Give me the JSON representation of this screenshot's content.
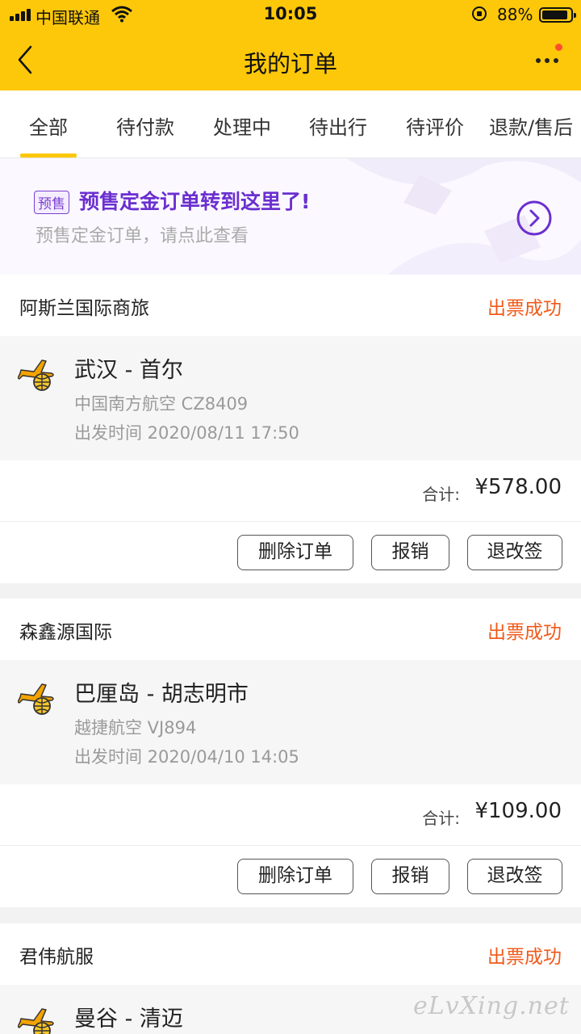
{
  "status_bar": {
    "carrier": "中国联通",
    "time": "10:05",
    "battery": "88%"
  },
  "nav": {
    "title": "我的订单",
    "back_icon": "chevron-left-icon",
    "more_icon": "more-dots-icon"
  },
  "tabs": [
    {
      "label": "全部",
      "active": true
    },
    {
      "label": "待付款",
      "active": false
    },
    {
      "label": "处理中",
      "active": false
    },
    {
      "label": "待出行",
      "active": false
    },
    {
      "label": "待评价",
      "active": false
    },
    {
      "label": "退款/售后",
      "active": false
    }
  ],
  "banner": {
    "badge": "预售",
    "title": "预售定金订单转到这里了!",
    "subtitle": "预售定金订单，请点此查看",
    "color": "#6b2fd0"
  },
  "orders": [
    {
      "shop": "阿斯兰国际商旅",
      "status": "出票成功",
      "route": "武汉 - 首尔",
      "airline": "中国南方航空 CZ8409",
      "depart": "出发时间 2020/08/11 17:50",
      "total_label": "合计:",
      "total": "¥578.00",
      "buttons": {
        "delete": "删除订单",
        "reimburse": "报销",
        "change": "退改签"
      }
    },
    {
      "shop": "森鑫源国际",
      "status": "出票成功",
      "route": "巴厘岛 - 胡志明市",
      "airline": "越捷航空 VJ894",
      "depart": "出发时间 2020/04/10 14:05",
      "total_label": "合计:",
      "total": "¥109.00",
      "buttons": {
        "delete": "删除订单",
        "reimburse": "报销",
        "change": "退改签"
      }
    },
    {
      "shop": "君伟航服",
      "status": "出票成功",
      "route": "曼谷 - 清迈"
    }
  ],
  "watermark": "eLvXing.net",
  "colors": {
    "header": "#fdc80a",
    "status_text": "#f05a1a"
  }
}
